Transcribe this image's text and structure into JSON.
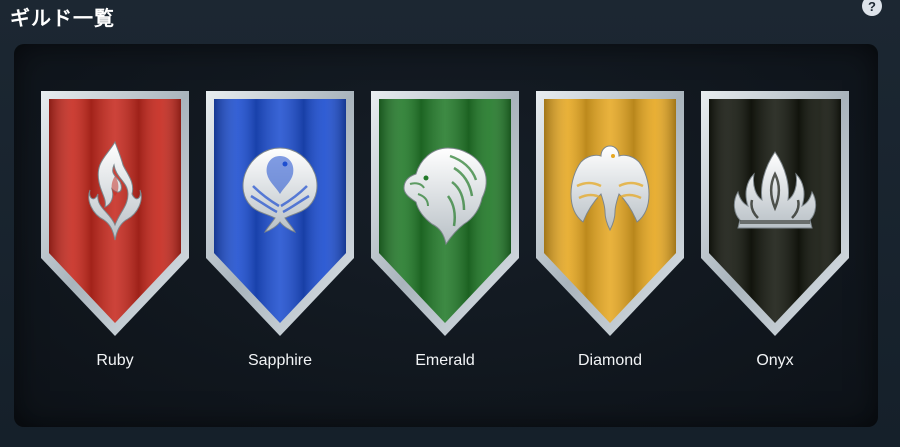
{
  "page": {
    "title": "ギルド一覧",
    "help_icon": "help-circle-icon",
    "help_glyph": "?"
  },
  "guilds": [
    {
      "name": "Ruby",
      "emblem": "flame-emblem-icon",
      "color": "#c62a1f"
    },
    {
      "name": "Sapphire",
      "emblem": "phoenix-emblem-icon",
      "color": "#1e4fd0"
    },
    {
      "name": "Emerald",
      "emblem": "lion-emblem-icon",
      "color": "#237a2a"
    },
    {
      "name": "Diamond",
      "emblem": "eagle-emblem-icon",
      "color": "#e6a823"
    },
    {
      "name": "Onyx",
      "emblem": "fire-crown-emblem-icon",
      "color": "#15180f"
    }
  ]
}
